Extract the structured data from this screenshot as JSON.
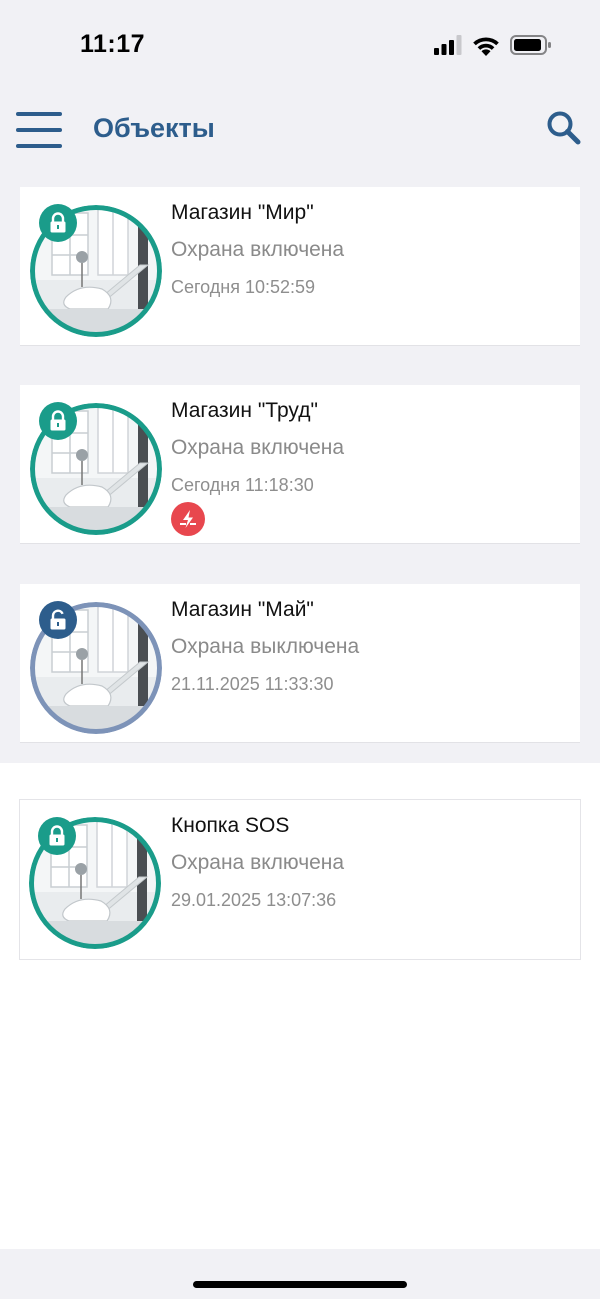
{
  "status_bar": {
    "time": "11:17",
    "icons": [
      "signal-icon",
      "wifi-icon",
      "battery-icon"
    ]
  },
  "header": {
    "title": "Объекты",
    "menu_icon": "hamburger-menu-icon",
    "search_icon": "search-icon"
  },
  "colors": {
    "accent": "#2d5d8c",
    "armed": "#1a9c8a",
    "disarmed_badge": "#2d5d8c",
    "disarmed_ring": "#7d93b8",
    "alert": "#e8474e",
    "background": "#f1f1f5"
  },
  "objects": [
    {
      "name": "Магазин \"Мир\"",
      "status": "Охрана включена",
      "time": "Сегодня 10:52:59",
      "state": "armed",
      "icon": "lock-closed-icon"
    },
    {
      "name": "Магазин \"Труд\"",
      "status": "Охрана включена",
      "time": "Сегодня 11:18:30",
      "state": "armed",
      "icon": "lock-closed-icon",
      "alert_icon": "power-failure-icon"
    },
    {
      "name": "Магазин \"Май\"",
      "status": "Охрана выключена",
      "time": "21.11.2025 11:33:30",
      "state": "disarmed",
      "icon": "lock-open-icon"
    },
    {
      "name": "Кнопка SOS",
      "status": "Охрана включена",
      "time": "29.01.2025 13:07:36",
      "state": "armed",
      "icon": "lock-closed-icon"
    }
  ]
}
